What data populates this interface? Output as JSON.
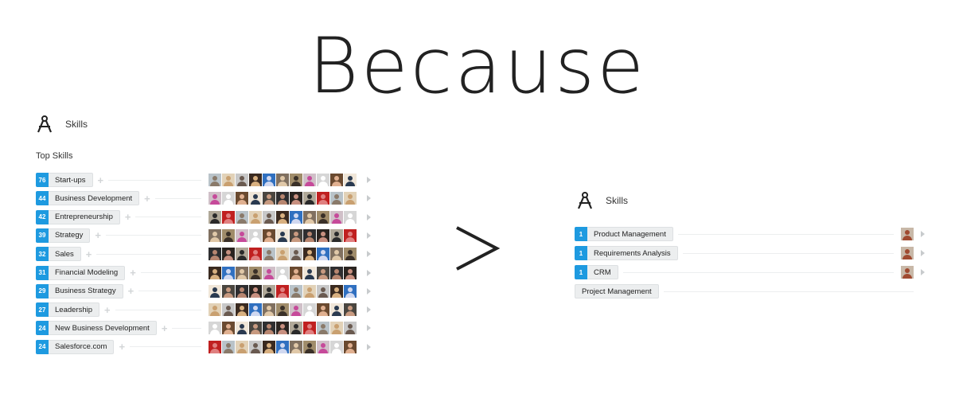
{
  "heading": "Because",
  "comparison_symbol": ">",
  "left_panel": {
    "section_title": "Skills",
    "icon": "compass-drafting-icon",
    "subheading": "Top Skills",
    "skills": [
      {
        "count": "76",
        "name": "Start-ups"
      },
      {
        "count": "44",
        "name": "Business Development"
      },
      {
        "count": "42",
        "name": "Entrepreneurship"
      },
      {
        "count": "39",
        "name": "Strategy"
      },
      {
        "count": "32",
        "name": "Sales"
      },
      {
        "count": "31",
        "name": "Financial Modeling"
      },
      {
        "count": "29",
        "name": "Business Strategy"
      },
      {
        "count": "27",
        "name": "Leadership"
      },
      {
        "count": "24",
        "name": "New Business Development"
      },
      {
        "count": "24",
        "name": "Salesforce.com"
      }
    ],
    "endorser_avatars_per_row": 11,
    "avatar_palette": [
      [
        "#b9c3c9",
        "#8a7a6a"
      ],
      [
        "#4a4640",
        "#c89a80"
      ],
      [
        "#a08c6a",
        "#3a3028"
      ],
      [
        "#e2d2b8",
        "#c9a070"
      ],
      [
        "#2e2e30",
        "#b88670"
      ],
      [
        "#d0c0c8",
        "#c64a9a"
      ],
      [
        "#c8c8c8",
        "#6a5a50"
      ],
      [
        "#2a2420",
        "#c89080"
      ],
      [
        "#d6d6d6",
        "#ffffff"
      ],
      [
        "#3a2a20",
        "#d8b080"
      ],
      [
        "#b0a898",
        "#2a2a2a"
      ],
      [
        "#6a4a30",
        "#e0b090"
      ],
      [
        "#3070c0",
        "#d0d8f0"
      ],
      [
        "#c02020",
        "#e08080"
      ],
      [
        "#f0e6d8",
        "#2a3a50"
      ],
      [
        "#807060",
        "#e0c8a8"
      ]
    ]
  },
  "right_panel": {
    "section_title": "Skills",
    "icon": "compass-drafting-icon",
    "skills": [
      {
        "count": "1",
        "name": "Product Management",
        "has_endorser": true
      },
      {
        "count": "1",
        "name": "Requirements Analysis",
        "has_endorser": true
      },
      {
        "count": "1",
        "name": "CRM",
        "has_endorser": true
      },
      {
        "count": "",
        "name": "Project Management",
        "has_endorser": false
      }
    ]
  },
  "colors": {
    "count_badge": "#1e9ae0",
    "pill_bg": "#eceeef",
    "text": "#222222"
  }
}
